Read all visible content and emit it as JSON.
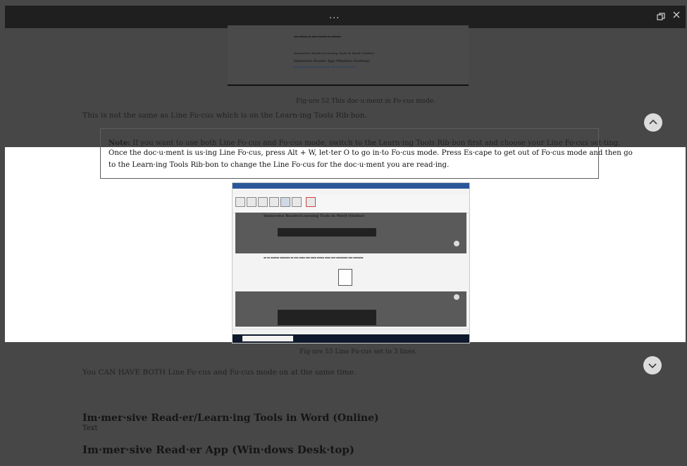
{
  "window": {
    "menu_dots": "...",
    "restore_icon": "restore-icon",
    "close_icon": "close-icon"
  },
  "captions": {
    "figure52": "Fig·ure 52 This doc·u·ment in Fo·cus mode.",
    "figure53": "Fig·ure 53 Line Fo·cus set to 3 lines."
  },
  "paragraphs": {
    "not_same": "This is not the same as Line Fo·cus which is on the Learn·ing Tools Rib·bon.",
    "both_modes": "You CAN HAVE BOTH Line Fo·cus and Fo·cus mode on at the same time."
  },
  "note": {
    "label": "Note:",
    "line1_text": " If you want to use both Line Fo·cus and Fo·cus mode, switch to the Learn·ing Tools Rib·bon first and choose your Line Fo·cus set·ting.",
    "line2": "Once the doc·u·ment is us·ing Line Fo·cus, press Alt + W, let·ter O to go in·to Fo·cus mode. Press Es·cape to get out of Fo·cus mode and then go",
    "line3": "to the Learn·ing Tools Rib·bon to change the Line Fo·cus for the doc·u·ment you are read·ing."
  },
  "sections": [
    {
      "heading": "Im·mer·sive Read·er/Learn·ing  Tools in Word (Online)",
      "body": "Text"
    },
    {
      "heading": "Im·mer·sive Read·er App (Win·dows Desk·top)",
      "body": ""
    }
  ],
  "embedded_doc": {
    "heading1": "Immersive Reader/Learning Tools in Word (Online)",
    "heading2": "Immersive Reader App (Windows Desktop)"
  },
  "navigation": {
    "up_icon": "chevron-up-icon",
    "down_icon": "chevron-down-icon"
  },
  "taskbar": {
    "search_placeholder": "Type here to search"
  }
}
